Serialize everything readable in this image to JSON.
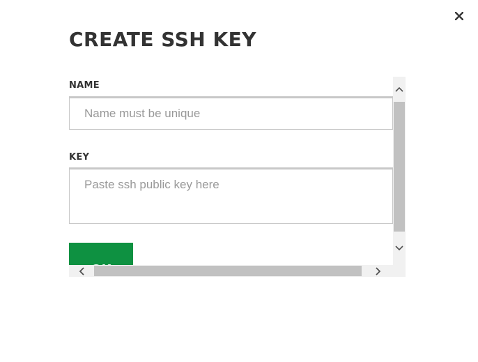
{
  "dialog": {
    "title": "CREATE SSH KEY",
    "close_icon": "close-icon"
  },
  "form": {
    "name_label": "NAME",
    "name_placeholder": "Name must be unique",
    "name_value": "",
    "key_label": "KEY",
    "key_placeholder": "Paste ssh public key here",
    "key_value": "",
    "ok_label": "OK"
  },
  "icons": {
    "scroll_up": "chevron-up-icon",
    "scroll_down": "chevron-down-icon",
    "scroll_left": "chevron-left-icon",
    "scroll_right": "chevron-right-icon"
  },
  "colors": {
    "accent": "#0e9141",
    "text": "#333333",
    "placeholder": "#999999",
    "border": "#c8c8c8",
    "scrollbar_track": "#f1f1f1",
    "scrollbar_thumb": "#c1c1c1"
  }
}
